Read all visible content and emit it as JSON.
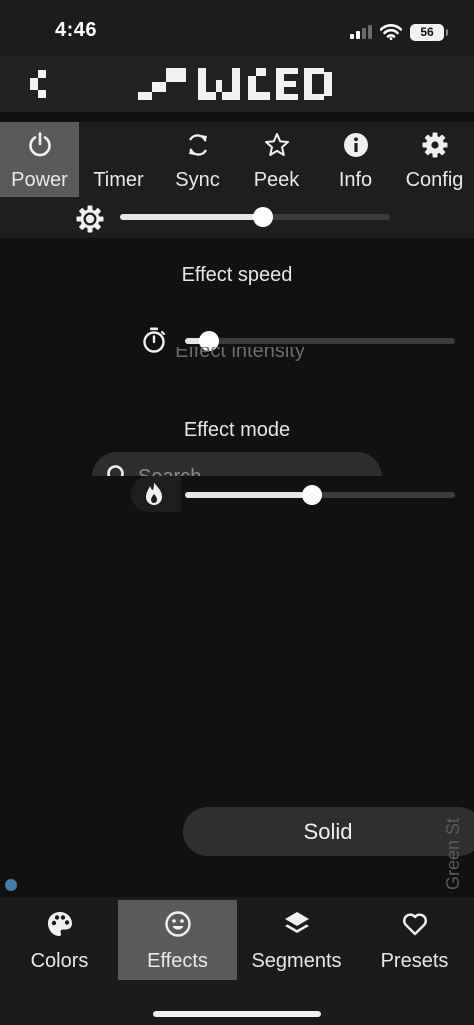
{
  "status_bar": {
    "time": "4:46",
    "battery": "56"
  },
  "header": {
    "logo_icon": "wled-pixel-logo",
    "back_icon": "back-chevron-icon"
  },
  "top_tabs": [
    {
      "label": "Power",
      "icon": "power-icon",
      "active": true
    },
    {
      "label": "Timer",
      "icon": "moon-icon",
      "active": false
    },
    {
      "label": "Sync",
      "icon": "sync-icon",
      "active": false
    },
    {
      "label": "Peek",
      "icon": "star-icon",
      "active": false
    },
    {
      "label": "Info",
      "icon": "info-icon",
      "active": false
    },
    {
      "label": "Config",
      "icon": "gear-icon",
      "active": false
    }
  ],
  "brightness": {
    "icon": "brightness-icon",
    "value": 0.53
  },
  "effect_speed": {
    "label": "Effect speed",
    "icon": "stopwatch-icon",
    "value": 0.09
  },
  "effect_intensity": {
    "label": "Effect intensity",
    "icon": "flame-icon",
    "value": 0.47
  },
  "effect_mode": {
    "label": "Effect mode",
    "search_placeholder": "Search"
  },
  "selected_effect": "Solid",
  "side_label": "Green St",
  "bottom_tabs": [
    {
      "label": "Colors",
      "icon": "palette-icon",
      "active": false
    },
    {
      "label": "Effects",
      "icon": "smiley-icon",
      "active": true
    },
    {
      "label": "Segments",
      "icon": "layers-icon",
      "active": false
    },
    {
      "label": "Presets",
      "icon": "heart-icon",
      "active": false
    }
  ],
  "colors": {
    "background": "#111111",
    "panel": "#1e1e1e",
    "active_tab": "#5a5a5a",
    "slider_fill": "#e6e6e6",
    "slider_track": "#3c3c3c",
    "dot": "#3d7fae"
  }
}
